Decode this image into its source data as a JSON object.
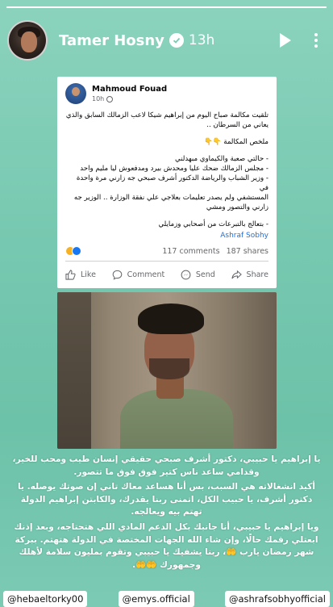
{
  "story": {
    "progress_fraction": 1.0,
    "username": "Tamer Hosny",
    "time": "13h",
    "play_icon": "play-icon",
    "more_icon": "more-icon",
    "verified_icon": "verified-badge-icon"
  },
  "fb_post": {
    "author": "Mahmoud Fouad",
    "time": "10h",
    "lines": [
      "تلقيت مكالمة صباح اليوم من إبراهيم شيكا لاعب الزمالك السابق والذي",
      "يعاني من السرطان ..",
      "",
      "ملخص المكالمة 👇👇",
      "",
      "- حالتي صعبة والكيماوي مبهدلني",
      "- مجلس الزمالك ضحك عليا ومحدش بيرد ومدفعوش ليا مليم واحد",
      "- وزير الشباب والرياضة الدكتور أشرف صبحي جه زارني مرة واحدة في",
      "المستشفي ولم يصدر تعليمات بعلاجي علي نفقة الوزارة .. الوزير جه",
      "زارني والتصور ومشي",
      "",
      "- بتعالج بالتبرعات من أصحابي وزمايلي"
    ],
    "signature": "Ashraf Sobhy",
    "comments": "117 comments",
    "shares": "187 shares",
    "actions": {
      "like": "Like",
      "comment": "Comment",
      "send": "Send",
      "share": "Share"
    }
  },
  "caption": [
    "يا إبراهيم يا حبيبي، دكتور أشرف صبحي حقيقي إنسان طيب ومحب للخير، وقدامي ساعد ناس كتير فوق فوق ما تتصور.",
    "أكيد انشغالاته هي السبب، بس أنا هساعد معاك تاني إن صوتك يوصله. يا دكتور أشرف، يا حبيب الكل، اتمنى ربنا يقدرك، والكابتن إبراهيم الدولة تهتم بيه ويعالجه.",
    "ويا إبراهيم يا حبيبي، أنا جانبك بكل الدعم المادي اللي هتحتاجه، وبعد إذنك ابعتلي رقمك حالًا، وإن شاء الله الجهات المختصة في الدولة هتهتم. ببركة شهر رمضان يارب 🤲، ربنا يشفيك يا حبيبي وتقوم بمليون سلامة لأهلك وجمهورك 🤲🤲."
  ],
  "tags": [
    "@hebaeltorky00",
    "@emys.official",
    "@ashrafsobhyofficial"
  ],
  "colors": {
    "background_top": "#8bd3bd",
    "background_bottom": "#6cc2a8",
    "fb_link": "#216fdb",
    "fb_text_secondary": "#65676b"
  }
}
